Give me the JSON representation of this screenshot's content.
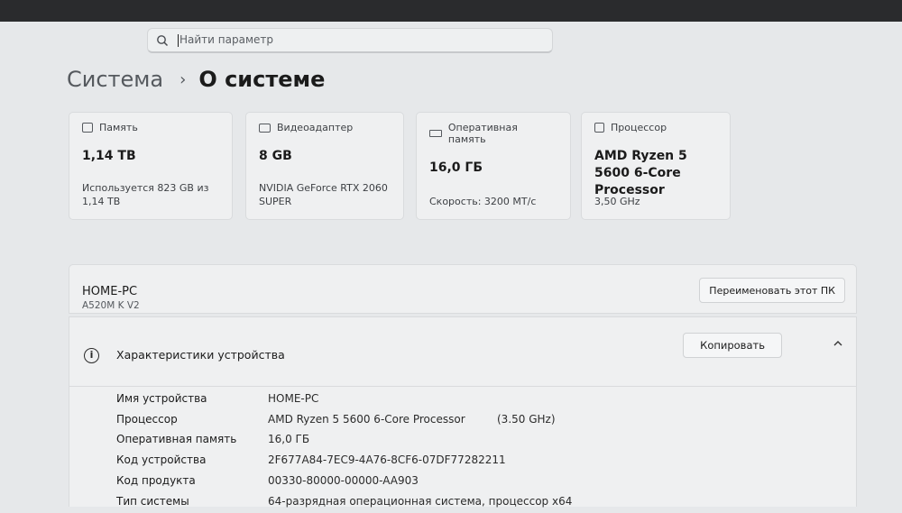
{
  "search": {
    "placeholder": "Найти параметр"
  },
  "breadcrumb": {
    "parent": "Система",
    "separator": "›",
    "current": "О системе"
  },
  "cards": [
    {
      "icon": "storage-icon",
      "label": "Память",
      "value": "1,14 TB",
      "sub": "Используется 823 GB из 1,14 TB"
    },
    {
      "icon": "gpu-icon",
      "label": "Видеоадаптер",
      "value": "8 GB",
      "sub": "NVIDIA GeForce RTX 2060 SUPER"
    },
    {
      "icon": "ram-icon",
      "label": "Оперативная память",
      "value": "16,0 ГБ",
      "sub": "Скорость: 3200 MT/c"
    },
    {
      "icon": "cpu-icon",
      "label": "Процессор",
      "value": "AMD Ryzen 5 5600 6-Core Processor",
      "sub": "3,50 GHz"
    }
  ],
  "device": {
    "name": "HOME-PC",
    "model": "A520M K V2",
    "rename_label": "Переименовать этот ПК"
  },
  "specs": {
    "title": "Характеристики устройства",
    "copy_label": "Копировать",
    "rows": [
      {
        "label": "Имя устройства",
        "value": "HOME-PC",
        "extra": ""
      },
      {
        "label": "Процессор",
        "value": "AMD Ryzen 5 5600 6-Core Processor",
        "extra": "(3.50 GHz)"
      },
      {
        "label": "Оперативная память",
        "value": "16,0 ГБ",
        "extra": ""
      },
      {
        "label": "Код устройства",
        "value": "2F677A84-7EC9-4A76-8CF6-07DF77282211",
        "extra": ""
      },
      {
        "label": "Код продукта",
        "value": "00330-80000-00000-AA903",
        "extra": ""
      },
      {
        "label": "Тип системы",
        "value": "64-разрядная операционная система, процессор x64",
        "extra": ""
      }
    ]
  }
}
